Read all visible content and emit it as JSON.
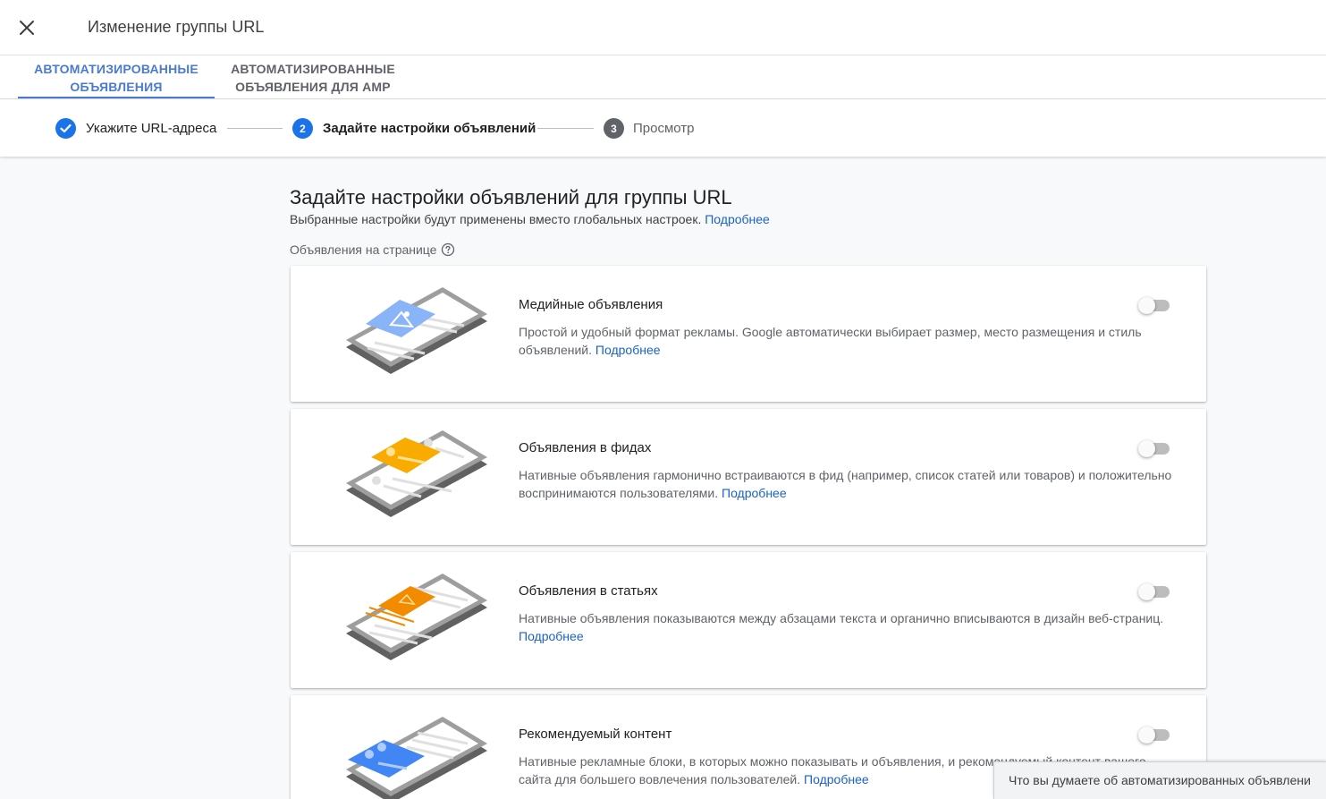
{
  "header": {
    "title": "Изменение группы URL"
  },
  "tabs": [
    {
      "label": "Автоматизированные объявления",
      "active": true
    },
    {
      "label": "Автоматизированные объявления для AMP",
      "active": false
    }
  ],
  "stepper": {
    "steps": [
      {
        "label": "Укажите URL-адреса",
        "state": "done"
      },
      {
        "number": "2",
        "label": "Задайте настройки объявлений",
        "state": "active"
      },
      {
        "number": "3",
        "label": "Просмотр",
        "state": "pending"
      }
    ]
  },
  "content": {
    "title": "Задайте настройки объявлений для группы URL",
    "subtitle": "Выбранные настройки будут применены вместо глобальных настроек.",
    "subtitle_link": "Подробнее",
    "section_label": "Объявления на странице"
  },
  "cards": [
    {
      "title": "Медийные объявления",
      "description": "Простой и удобный формат рекламы. Google автоматически выбирает размер, место размещения и стиль объявлений.",
      "link": "Подробнее",
      "accent": "#8ab4f8",
      "toggle_on": false
    },
    {
      "title": "Объявления в фидах",
      "description": "Нативные объявления гармонично встраиваются в фид (например, список статей или товаров) и положительно воспринимаются пользователями.",
      "link": "Подробнее",
      "accent": "#f9ab00",
      "toggle_on": false
    },
    {
      "title": "Объявления в статьях",
      "description": "Нативные объявления показываются между абзацами текста и органично вписываются в дизайн веб-страниц.",
      "link": "Подробнее",
      "accent": "#f28b00",
      "toggle_on": false
    },
    {
      "title": "Рекомендуемый контент",
      "description": "Нативные рекламные блоки, в которых можно показывать и объявления, и рекомендуемый контент вашего сайта для большего вовлечения пользователей.",
      "link": "Подробнее",
      "accent": "#4285f4",
      "toggle_on": false
    }
  ],
  "feedback": {
    "label": "Что вы думаете об автоматизированных объявлени"
  },
  "colors": {
    "primary": "#1a73e8",
    "tab_active": "#4a7bd0",
    "link": "#1a62c4"
  }
}
